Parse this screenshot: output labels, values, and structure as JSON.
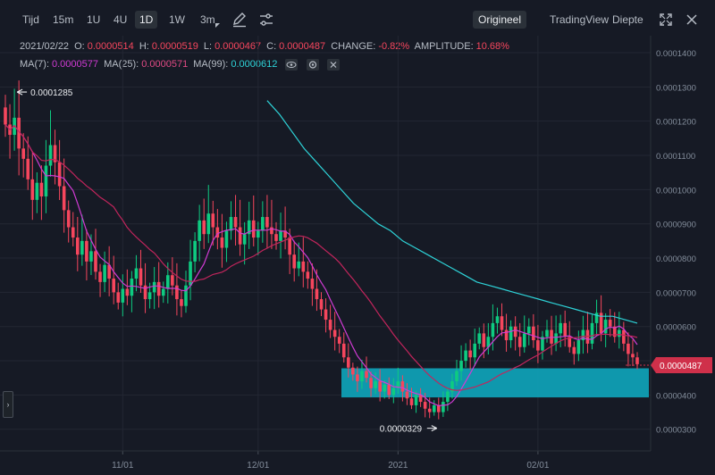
{
  "toolbar": {
    "timeframes": [
      {
        "label": "Tijd",
        "x": 0,
        "active": false
      },
      {
        "label": "15m",
        "x": 0,
        "active": false
      },
      {
        "label": "1U",
        "x": 0,
        "active": false
      },
      {
        "label": "4U",
        "x": 0,
        "active": false
      },
      {
        "label": "1D",
        "x": 0,
        "active": true
      },
      {
        "label": "1W",
        "x": 0,
        "active": false
      },
      {
        "label": "3m",
        "x": 0,
        "active": false
      }
    ],
    "views": [
      "Origineel",
      "TradingView",
      "Diepte"
    ],
    "active_view": "Origineel"
  },
  "info_line": {
    "date": "2021/02/22",
    "open_label": "O:",
    "open": "0.0000514",
    "high_label": "H:",
    "high": "0.0000519",
    "low_label": "L:",
    "low": "0.0000467",
    "close_label": "C:",
    "close": "0.0000487",
    "change_label": "CHANGE:",
    "change": "-0.82%",
    "amplitude_label": "AMPLITUDE:",
    "amplitude": "10.68%"
  },
  "ma_line": {
    "ma7_label": "MA(7):",
    "ma7": "0.0000577",
    "ma25_label": "MA(25):",
    "ma25": "0.0000571",
    "ma99_label": "MA(99):",
    "ma99": "0.0000612"
  },
  "colors": {
    "up": "#0ecb81",
    "down": "#f6465d",
    "ma7": "#d13bd4",
    "ma25": "#c2255c",
    "ma99": "#2ed3d8",
    "highlight": "#0fa3b8",
    "background": "#161a25",
    "grid": "#232733",
    "price_tag": "#cf304a"
  },
  "icons": [
    "pencil-icon",
    "sliders-icon",
    "expand-icon",
    "close-icon",
    "eye-icon",
    "settings-icon",
    "close-small-icon",
    "chevron-right-icon"
  ],
  "chart_data": {
    "type": "candlestick",
    "ylim": [
      2.6e-05,
      0.000146
    ],
    "y_ticks": [
      "0.0001400",
      "0.0001300",
      "0.0001200",
      "0.0001100",
      "0.0001000",
      "0.0000900",
      "0.0000800",
      "0.0000700",
      "0.0000600",
      "0.0000500",
      "0.0000400",
      "0.0000300"
    ],
    "y_tick_values": [
      0.00014,
      0.00013,
      0.00012,
      0.00011,
      0.0001,
      9e-05,
      8e-05,
      7e-05,
      6e-05,
      5e-05,
      4e-05,
      3e-05
    ],
    "x_ticks": [
      {
        "label": "11/01",
        "index": 26
      },
      {
        "label": "12/01",
        "index": 56
      },
      {
        "label": "2021",
        "index": 87
      },
      {
        "label": "02/01",
        "index": 118
      }
    ],
    "current_price": "0.0000487",
    "current_price_value": 4.87e-05,
    "high_marker": {
      "label": "0.0001285",
      "index": 2,
      "value": 0.0001285
    },
    "low_marker": {
      "label": "0.0000329",
      "index": 96,
      "value": 3.29e-05
    },
    "highlight_zone": {
      "from_index": 78,
      "to_index": 146,
      "y_low": 3.93e-05,
      "y_high": 4.78e-05
    },
    "candles_close": [
      0.000119,
      0.000116,
      0.000121,
      0.000112,
      0.000109,
      0.000103,
      9.7e-05,
      0.000102,
      9.8e-05,
      0.000107,
      0.000113,
      0.000108,
      0.000101,
      9.4e-05,
      8.9e-05,
      8.6e-05,
      8.1e-05,
      8.5e-05,
      7.9e-05,
      8.2e-05,
      7.6e-05,
      7.3e-05,
      7.8e-05,
      7.4e-05,
      7e-05,
      6.7e-05,
      7.1e-05,
      6.9e-05,
      7.4e-05,
      7.7e-05,
      7.2e-05,
      6.8e-05,
      7e-05,
      7.3e-05,
      6.9e-05,
      7.1e-05,
      7.5e-05,
      7.2e-05,
      6.8e-05,
      6.6e-05,
      7.2e-05,
      7.9e-05,
      8.5e-05,
      9.1e-05,
      8.7e-05,
      9.3e-05,
      8.9e-05,
      8.6e-05,
      8.3e-05,
      8.8e-05,
      9.2e-05,
      8.9e-05,
      8.4e-05,
      8.7e-05,
      9.1e-05,
      8.6e-05,
      8.8e-05,
      9.2e-05,
      8.9e-05,
      8.7e-05,
      8.5e-05,
      8.8e-05,
      8.6e-05,
      8.1e-05,
      7.7e-05,
      7.9e-05,
      7.6e-05,
      7.4e-05,
      7.1e-05,
      6.8e-05,
      6.5e-05,
      6.2e-05,
      5.9e-05,
      5.7e-05,
      5.5e-05,
      5.1e-05,
      4.8e-05,
      4.6e-05,
      4.4e-05,
      4.7e-05,
      4.5e-05,
      4.2e-05,
      4.4e-05,
      4.1e-05,
      4.3e-05,
      4e-05,
      4.2e-05,
      4.4e-05,
      4.1e-05,
      3.9e-05,
      3.7e-05,
      4e-05,
      3.8e-05,
      3.6e-05,
      3.5e-05,
      3.7e-05,
      3.5e-05,
      3.8e-05,
      4.1e-05,
      4.4e-05,
      4.7e-05,
      5e-05,
      5.3e-05,
      5.1e-05,
      5.5e-05,
      5.8e-05,
      5.4e-05,
      5.7e-05,
      6.1e-05,
      6.3e-05,
      5.9e-05,
      5.6e-05,
      6e-05,
      5.7e-05,
      5.4e-05,
      5.8e-05,
      6e-05,
      5.6e-05,
      5.3e-05,
      5.7e-05,
      5.9e-05,
      5.5e-05,
      5.8e-05,
      6.1e-05,
      5.7e-05,
      5.4e-05,
      5.2e-05,
      5.6e-05,
      5.9e-05,
      5.5e-05,
      6.1e-05,
      6.4e-05,
      5.8e-05,
      6.2e-05,
      6e-05,
      5.7e-05,
      5.9e-05,
      5.5e-05,
      5.2e-05,
      5.1e-05,
      4.9e-05
    ],
    "ma99_values_start_index": 67,
    "ma99_values": [
      0.000126,
      0.000122,
      0.000117,
      0.000112,
      0.000108,
      0.000104,
      0.0001,
      9.6e-05,
      9.3e-05,
      9e-05,
      8.8e-05,
      8.5e-05,
      8.3e-05,
      8.1e-05,
      7.9e-05,
      7.7e-05,
      7.5e-05,
      7.3e-05,
      7.2e-05,
      7.1e-05,
      7e-05,
      6.9e-05,
      6.8e-05,
      6.7e-05,
      6.6e-05,
      6.5e-05,
      6.4e-05,
      6.3e-05,
      6.3e-05,
      6.2e-05,
      6.1e-05
    ]
  }
}
